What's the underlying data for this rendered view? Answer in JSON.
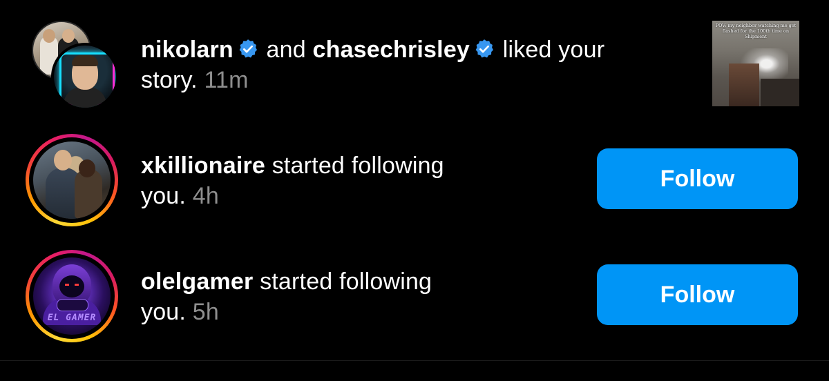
{
  "notifications": [
    {
      "user1": "nikolarn",
      "connector": "and",
      "user2": "chasechrisley",
      "action": "liked your",
      "action_cont": "story.",
      "time": "11m",
      "thumbnail_caption": "POV: my neighbor watching me get flashed for the 100th time on Shipment"
    },
    {
      "user": "xkillionaire",
      "action": "started following",
      "action_cont": "you.",
      "time": "4h",
      "button": "Follow"
    },
    {
      "user": "olelgamer",
      "action": "started following",
      "action_cont": "you.",
      "time": "5h",
      "button": "Follow",
      "avatar_tag": "EL GAMER"
    }
  ],
  "colors": {
    "background": "#000000",
    "button": "#0095f6",
    "verified": "#3897f0",
    "timestamp": "#8e8e8e"
  },
  "icons": {
    "verified": "verified-badge-icon"
  }
}
